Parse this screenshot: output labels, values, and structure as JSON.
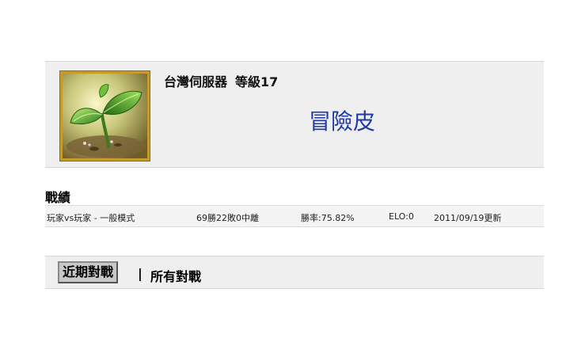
{
  "profile": {
    "server": "台灣伺服器",
    "level_label": "等級17",
    "player_name": "冒險皮",
    "avatar_icon": "sprout-icon"
  },
  "stats": {
    "heading": "戰績",
    "mode": "玩家vs玩家 - 一般模式",
    "record": "69勝22敗0中離",
    "win_rate": "勝率:75.82%",
    "elo": "ELO:0",
    "updated": "2011/09/19更新"
  },
  "tabs": {
    "recent": "近期對戰",
    "separator": "|",
    "all": "所有對戰"
  }
}
